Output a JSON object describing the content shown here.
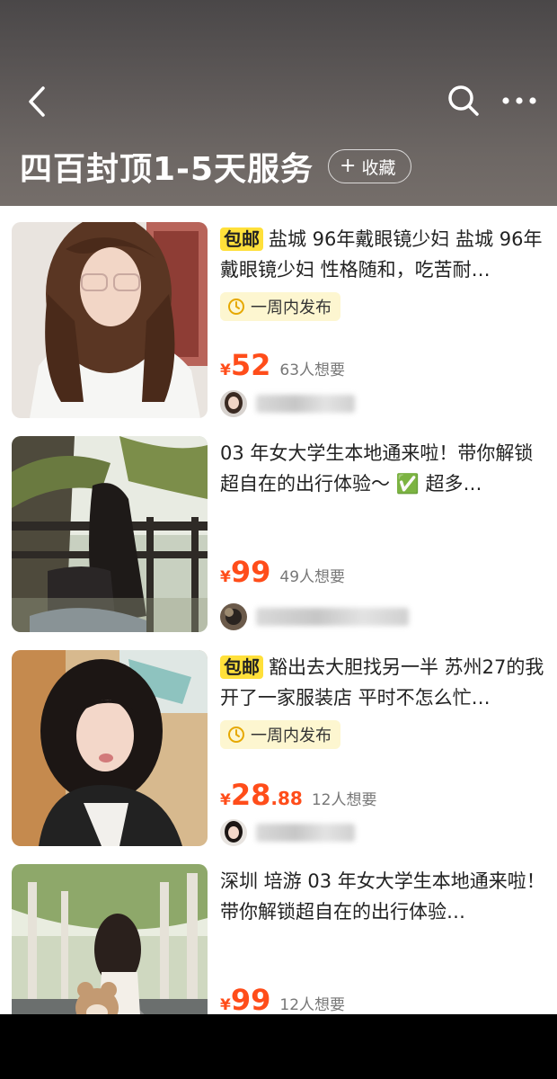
{
  "header": {
    "title": "四百封顶1-5天服务",
    "favorite_plus": "+",
    "favorite_label": "收藏"
  },
  "items": [
    {
      "free_shipping": "包邮",
      "description": "盐城 96年戴眼镜少妇 盐城 96年戴眼镜少妇 性格随和，吃苦耐…",
      "time_tag": "一周内发布",
      "currency": "¥",
      "price_int": "52",
      "price_dec": "",
      "wants": "63人想要"
    },
    {
      "free_shipping": "",
      "description": "03 年女大学生本地通来啦！带你解锁超自在的出行体验～ ✅ 超多…",
      "time_tag": "",
      "currency": "¥",
      "price_int": "99",
      "price_dec": "",
      "wants": "49人想要"
    },
    {
      "free_shipping": "包邮",
      "description": "豁出去大胆找另一半 苏州27的我开了一家服装店 平时不怎么忙…",
      "time_tag": "一周内发布",
      "currency": "¥",
      "price_int": "28",
      "price_dec": ".88",
      "wants": "12人想要"
    },
    {
      "free_shipping": "",
      "description": "深圳 培游 03 年女大学生本地通来啦！带你解锁超自在的出行体验…",
      "time_tag": "",
      "currency": "¥",
      "price_int": "99",
      "price_dec": "",
      "wants": "12人想要"
    }
  ],
  "colors": {
    "price": "#ff4d1a",
    "ship_tag_bg": "#ffe03a",
    "time_tag_bg": "#fdf6d0",
    "time_tag_icon": "#e6a800"
  },
  "icons": {
    "back": "chevron-left-icon",
    "search": "search-icon",
    "more": "more-icon",
    "time": "clock-icon"
  }
}
